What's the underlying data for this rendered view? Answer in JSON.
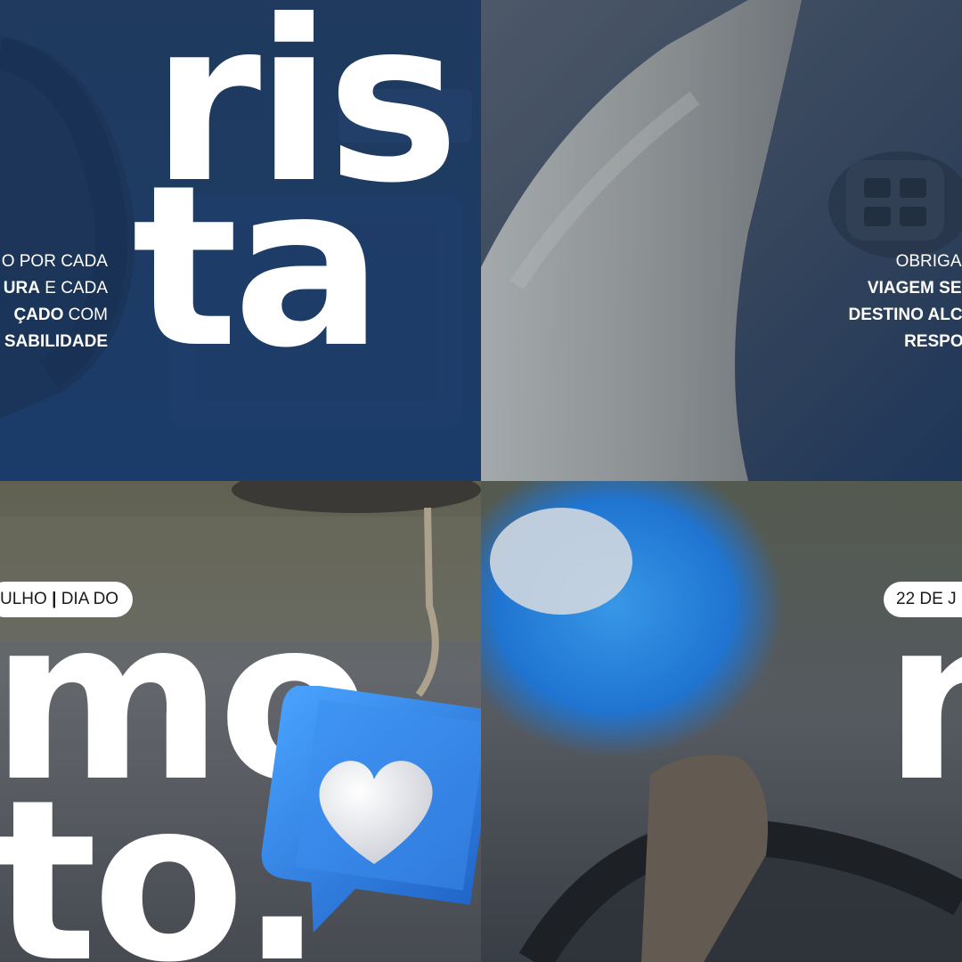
{
  "tiles": {
    "top_left": {
      "big_word_line1": "ris",
      "big_word_line2": "ta",
      "message_lines": [
        {
          "regular": "O POR CADA",
          "bold": ""
        },
        {
          "bold": "URA",
          "regular": " E CADA"
        },
        {
          "bold": "ÇADO",
          "regular": " COM"
        },
        {
          "bold": "SABILIDADE",
          "regular": ""
        }
      ]
    },
    "top_right": {
      "message_lines": [
        {
          "regular": "OBRIGADO",
          "bold": ""
        },
        {
          "bold": "VIAGEM SEGU",
          "regular": ""
        },
        {
          "bold": "DESTINO ALCAN",
          "regular": ""
        },
        {
          "bold": "RESPONS",
          "regular": ""
        }
      ]
    },
    "bottom_left": {
      "date_pill_a": "ULHO",
      "date_pill_sep": "|",
      "date_pill_b": "DIA DO",
      "big_word_line1": "mo",
      "big_word_line2": "to."
    },
    "bottom_right": {
      "date_pill": "22 DE J",
      "big_word": "n"
    }
  },
  "icons": [
    "heart-icon",
    "like-bubble-icon"
  ],
  "colors": {
    "navy_overlay": "#1d3f6e",
    "bubble_blue": "#2e7be0",
    "white": "#ffffff"
  }
}
